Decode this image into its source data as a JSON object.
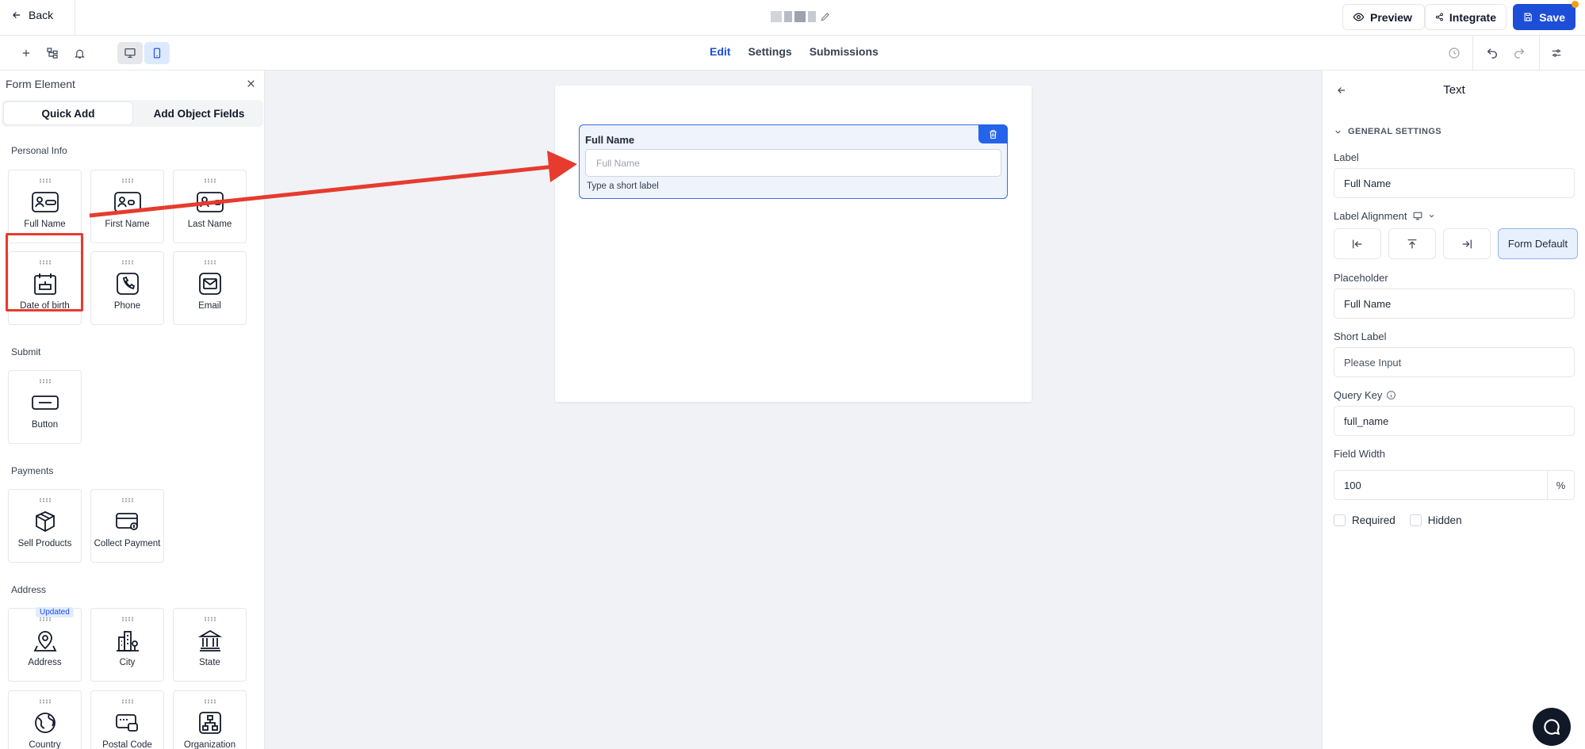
{
  "topbar": {
    "back_label": "Back",
    "preview_label": "Preview",
    "integrate_label": "Integrate",
    "save_label": "Save"
  },
  "toolbar": {
    "tabs": [
      {
        "label": "Edit",
        "active": true
      },
      {
        "label": "Settings",
        "active": false
      },
      {
        "label": "Submissions",
        "active": false
      }
    ]
  },
  "left_panel": {
    "title": "Form Element",
    "tabs": [
      "Quick Add",
      "Add Object Fields"
    ],
    "sections": [
      {
        "title": "Personal Info",
        "items": [
          "Full Name",
          "First Name",
          "Last Name",
          "Date of birth",
          "Phone",
          "Email"
        ]
      },
      {
        "title": "Submit",
        "items": [
          "Button"
        ]
      },
      {
        "title": "Payments",
        "items": [
          "Sell Products",
          "Collect Payment"
        ]
      },
      {
        "title": "Address",
        "badge": "Updated",
        "items": [
          "Address",
          "City",
          "State",
          "Country",
          "Postal Code",
          "Organization"
        ]
      }
    ]
  },
  "canvas": {
    "field": {
      "label": "Full Name",
      "placeholder": "Full Name",
      "short_label": "Type a short label"
    }
  },
  "right_panel": {
    "title": "Text",
    "section": "GENERAL SETTINGS",
    "label_title": "Label",
    "label_value": "Full Name",
    "alignment_title": "Label Alignment",
    "alignment_selected": "Form Default",
    "placeholder_title": "Placeholder",
    "placeholder_value": "Full Name",
    "short_label_title": "Short Label",
    "short_label_placeholder": "Please Input",
    "query_key_title": "Query Key",
    "query_key_value": "full_name",
    "field_width_title": "Field Width",
    "field_width_value": "100",
    "field_width_unit": "%",
    "required_label": "Required",
    "hidden_label": "Hidden"
  },
  "colors": {
    "primary": "#1d4ed8",
    "annotation": "#e63b2e",
    "canvas_bg": "#f0f2f5"
  }
}
